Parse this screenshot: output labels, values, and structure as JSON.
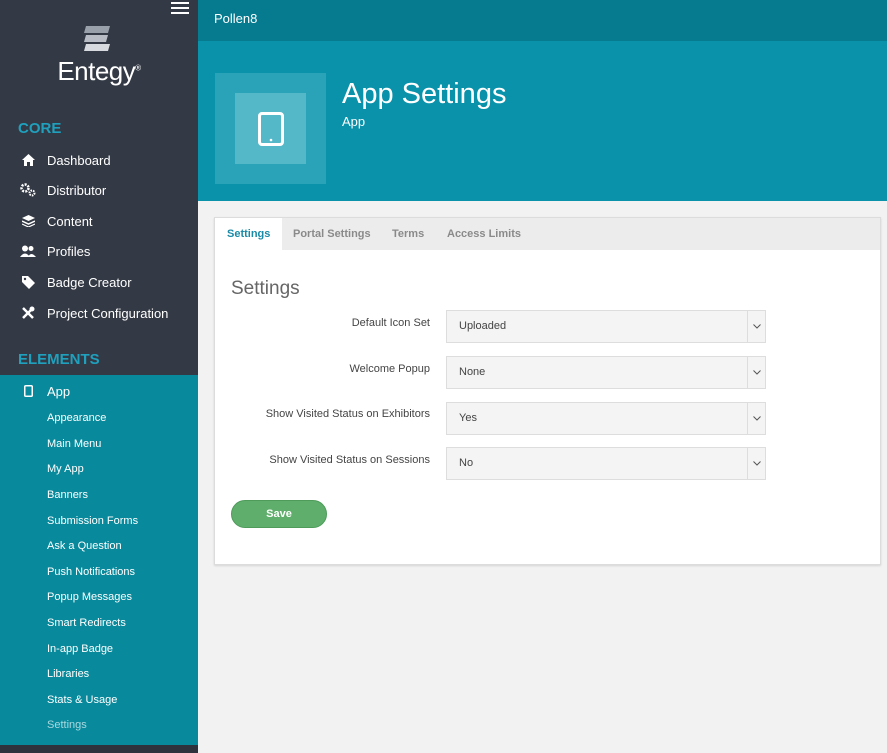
{
  "brand": {
    "logo_text": "Entegy",
    "logo_mark": "®"
  },
  "topbar": {
    "title": "Pollen8"
  },
  "sidebar": {
    "core_title": "CORE",
    "core_items": [
      {
        "label": "Dashboard",
        "icon": "home-icon"
      },
      {
        "label": "Distributor",
        "icon": "gears-icon"
      },
      {
        "label": "Content",
        "icon": "layers-icon"
      },
      {
        "label": "Profiles",
        "icon": "users-icon"
      },
      {
        "label": "Badge Creator",
        "icon": "tag-icon"
      },
      {
        "label": "Project Configuration",
        "icon": "tools-icon"
      }
    ],
    "elements_title": "ELEMENTS",
    "app_item": {
      "label": "App",
      "icon": "tablet-icon"
    },
    "app_sub_items": [
      "Appearance",
      "Main Menu",
      "My App",
      "Banners",
      "Submission Forms",
      "Ask a Question",
      "Push Notifications",
      "Popup Messages",
      "Smart Redirects",
      "In-app Badge",
      "Libraries",
      "Stats & Usage",
      "Settings"
    ]
  },
  "header": {
    "title": "App Settings",
    "subtitle": "App",
    "icon": "tablet-icon"
  },
  "tabs": [
    "Settings",
    "Portal Settings",
    "Terms",
    "Access Limits"
  ],
  "active_tab": "Settings",
  "form": {
    "heading": "Settings",
    "fields": [
      {
        "label": "Default Icon Set",
        "value": "Uploaded"
      },
      {
        "label": "Welcome Popup",
        "value": "None"
      },
      {
        "label": "Show Visited Status on Exhibitors",
        "value": "Yes"
      },
      {
        "label": "Show Visited Status on Sessions",
        "value": "No"
      }
    ],
    "save_label": "Save"
  },
  "colors": {
    "sidebar_bg": "#343a45",
    "accent": "#1fa0bd",
    "app_block_bg": "#088a9c",
    "header_bg": "#0a92ab",
    "save_green": "#5fae6c"
  }
}
